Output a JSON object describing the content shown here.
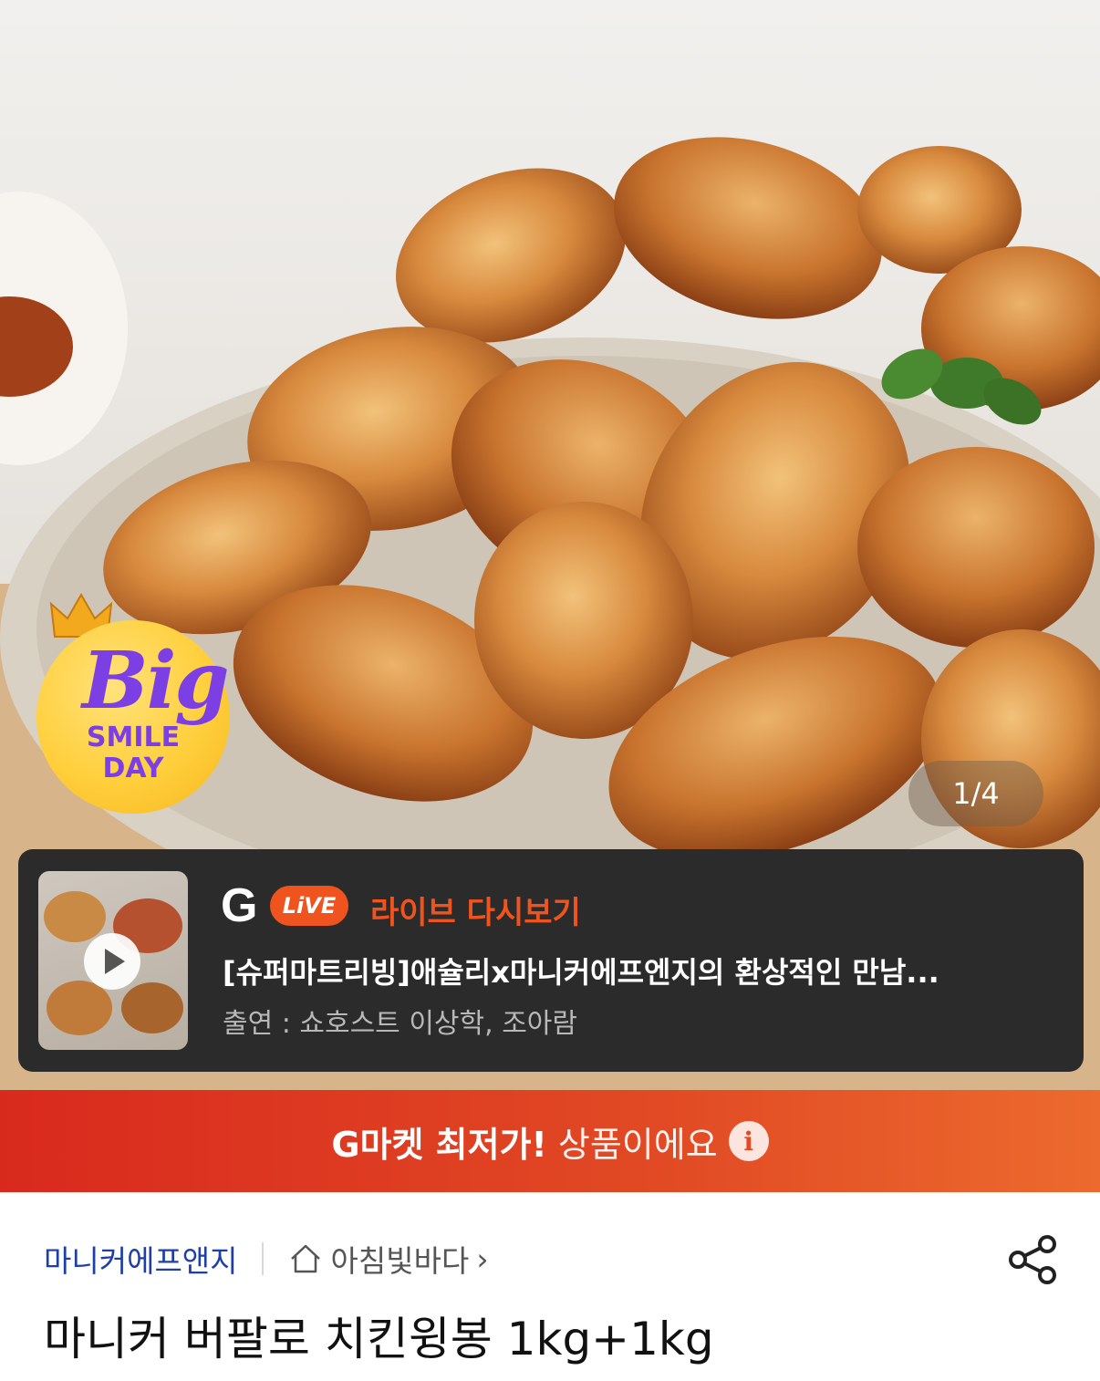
{
  "hero": {
    "badge": {
      "big": "Big",
      "line1": "SMILE",
      "line2": "DAY"
    },
    "pager": "1/4"
  },
  "live": {
    "logo_g": "G",
    "logo_live": "LiVE",
    "label": "라이브 다시보기",
    "name": "[슈퍼마트리빙]애슐리x마니커에프엔지의 환상적인 만남...",
    "cast": "출연 : 쇼호스트 이상학, 조아람"
  },
  "promo": {
    "strong": "G마켓 최저가!",
    "weak": "상품이에요",
    "info_icon": "i"
  },
  "product": {
    "brand": "마니커에프앤지",
    "shop": "아침빛바다",
    "shop_chevron": "›",
    "title": "마니커 버팔로 치킨윙봉 1kg+1kg"
  },
  "colors": {
    "accent_orange": "#f0541e",
    "promo_red": "#d9291e",
    "brand_blue": "#1f3fa8",
    "badge_purple": "#7b3fe4"
  }
}
